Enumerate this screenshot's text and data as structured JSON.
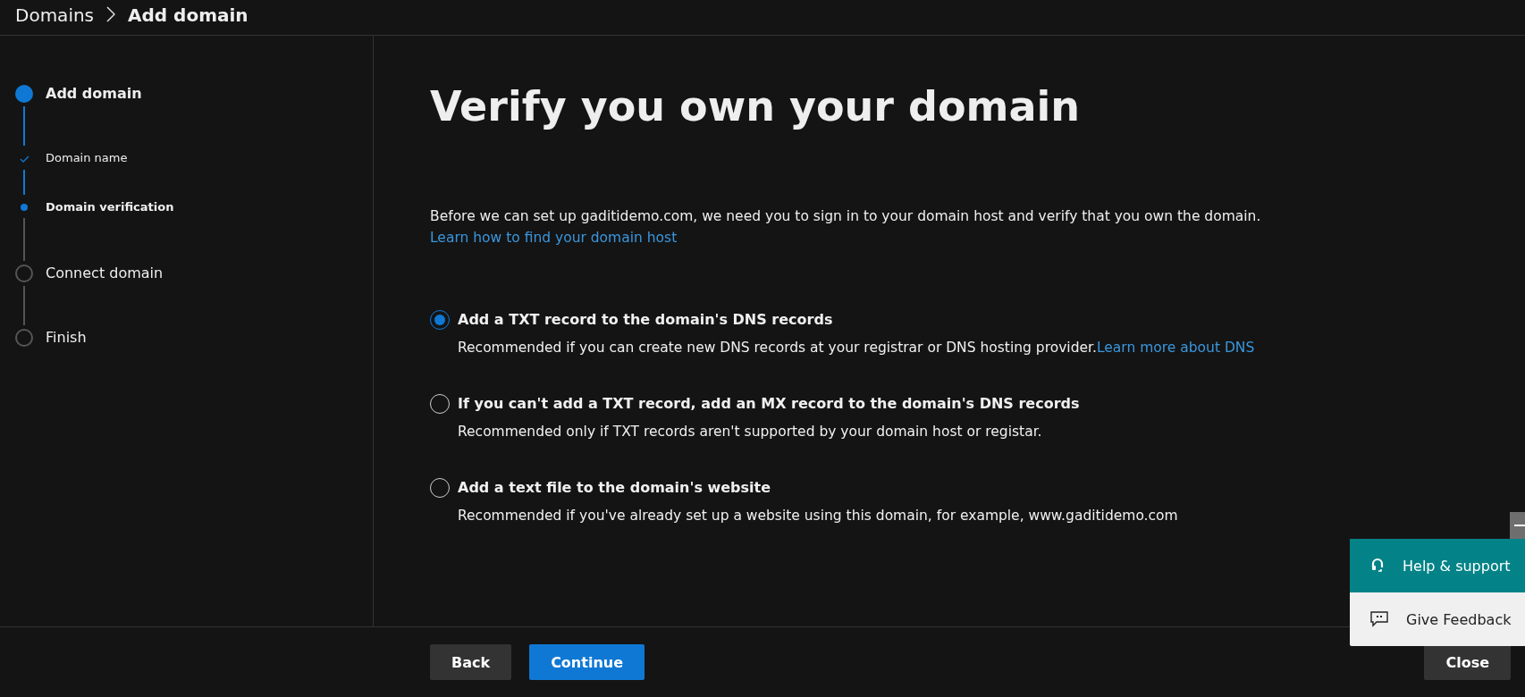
{
  "breadcrumb": [
    {
      "label": "Domains",
      "current": false
    },
    {
      "label": "Add domain",
      "current": true
    }
  ],
  "steps": [
    {
      "label": "Add domain",
      "kind": "step",
      "current": true,
      "completed": false
    },
    {
      "label": "Domain name",
      "kind": "substep",
      "current": false,
      "completed": true
    },
    {
      "label": "Domain verification",
      "kind": "substep",
      "current": true,
      "completed": false
    },
    {
      "label": "Connect domain",
      "kind": "step",
      "current": false,
      "completed": false
    },
    {
      "label": "Finish",
      "kind": "step",
      "current": false,
      "completed": false
    }
  ],
  "heading": "Verify you own your domain",
  "intro": {
    "text": "Before we can set up gaditidemo.com, we need you to sign in to your domain host and verify that you own the domain.",
    "link": "Learn how to find your domain host"
  },
  "options": [
    {
      "label": "Add a TXT record to the domain's DNS records",
      "description": "Recommended if you can create new DNS records at your registrar or DNS hosting provider.",
      "link": "Learn more about DNS",
      "selected": true
    },
    {
      "label": "If you can't add a TXT record, add an MX record to the domain's DNS records",
      "description": "Recommended only if TXT records aren't supported by your domain host or registar.",
      "selected": false
    },
    {
      "label": "Add a text file to the domain's website",
      "description": "Recommended if you've already set up a website using this domain, for example, www.gaditidemo.com",
      "selected": false
    }
  ],
  "help_panel": {
    "items": [
      {
        "label": "Help & support",
        "kind": "help"
      },
      {
        "label": "Give Feedback",
        "kind": "feedback"
      }
    ]
  },
  "footer": {
    "back": "Back",
    "continue": "Continue",
    "close": "Close"
  }
}
